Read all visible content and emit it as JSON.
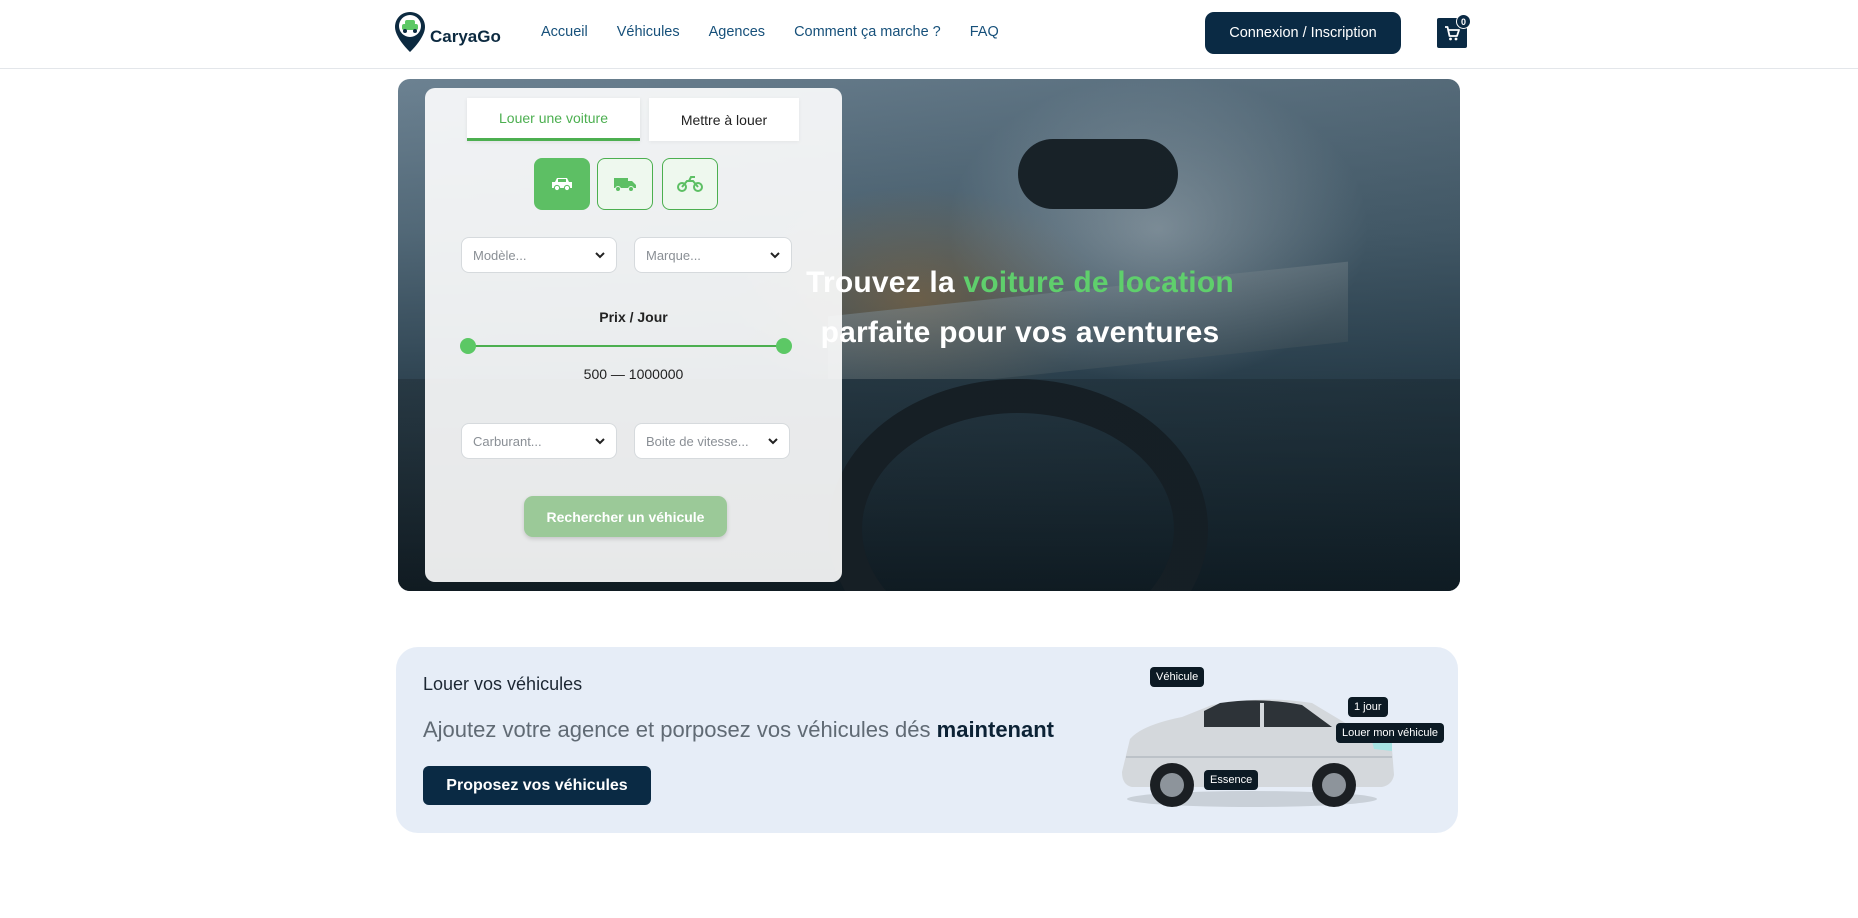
{
  "header": {
    "logo_text": "CaryaGo",
    "nav": [
      "Accueil",
      "Véhicules",
      "Agences",
      "Comment ça marche ?",
      "FAQ"
    ],
    "login_label": "Connexion / Inscription",
    "cart_count": "0"
  },
  "hero": {
    "title_part1": "Trouvez la ",
    "title_highlight": "voiture de location",
    "title_part2": "parfaite pour vos aventures",
    "highlight_color": "#5fcf6c"
  },
  "search": {
    "tab_rent": "Louer une voiture",
    "tab_list": "Mettre à louer",
    "vehicle_types": [
      "car-icon",
      "truck-icon",
      "motorcycle-icon"
    ],
    "model_placeholder": "Modèle...",
    "brand_placeholder": "Marque...",
    "price_label": "Prix / Jour",
    "price_range": "500 — 1000000",
    "fuel_placeholder": "Carburant...",
    "gearbox_placeholder": "Boite de vitesse...",
    "search_button": "Rechercher un véhicule"
  },
  "promo": {
    "subtitle": "Louer vos véhicules",
    "text": "Ajoutez votre agence et porposez vos véhicules dés ",
    "text_bold": "maintenant",
    "button": "Proposez vos véhicules",
    "tags": [
      "Véhicule",
      "1 jour",
      "Louer mon véhicule",
      "Essence"
    ]
  },
  "colors": {
    "navy": "#0a2a44",
    "green": "#4caf50",
    "promo_bg": "#e6edf7"
  }
}
